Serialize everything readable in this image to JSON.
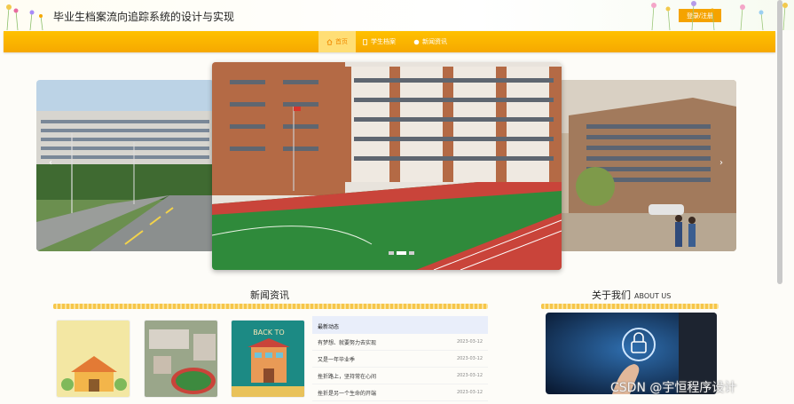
{
  "header": {
    "site_title": "毕业生档案流向追踪系统的设计与实现",
    "login_button": "登录/注册"
  },
  "nav": {
    "items": [
      {
        "label": "首页",
        "icon": "home-icon",
        "active": true
      },
      {
        "label": "学生档案",
        "icon": "file-icon",
        "active": false
      },
      {
        "label": "新闻资讯",
        "icon": "circle-icon",
        "active": false
      }
    ]
  },
  "carousel": {
    "slide_count": 3,
    "active_index": 1
  },
  "news_section": {
    "title": "新闻资讯",
    "panel_header": "最新动态",
    "items": [
      {
        "title": "有梦想、就要努力去实现",
        "date": "2023-03-12"
      },
      {
        "title": "又是一年毕业季",
        "date": "2023-03-12"
      },
      {
        "title": "挫折路上，坚持常在心间",
        "date": "2023-03-12"
      },
      {
        "title": "挫折是另一个生命的开端",
        "date": "2023-03-12"
      }
    ]
  },
  "about_section": {
    "title": "关于我们",
    "subtitle": "ABOUT US"
  },
  "watermark": "CSDN @宇恒程序设计",
  "colors": {
    "accent": "#f6a800",
    "nav_active_bg": "#ffde75",
    "nav_active_text": "#f08a00"
  }
}
